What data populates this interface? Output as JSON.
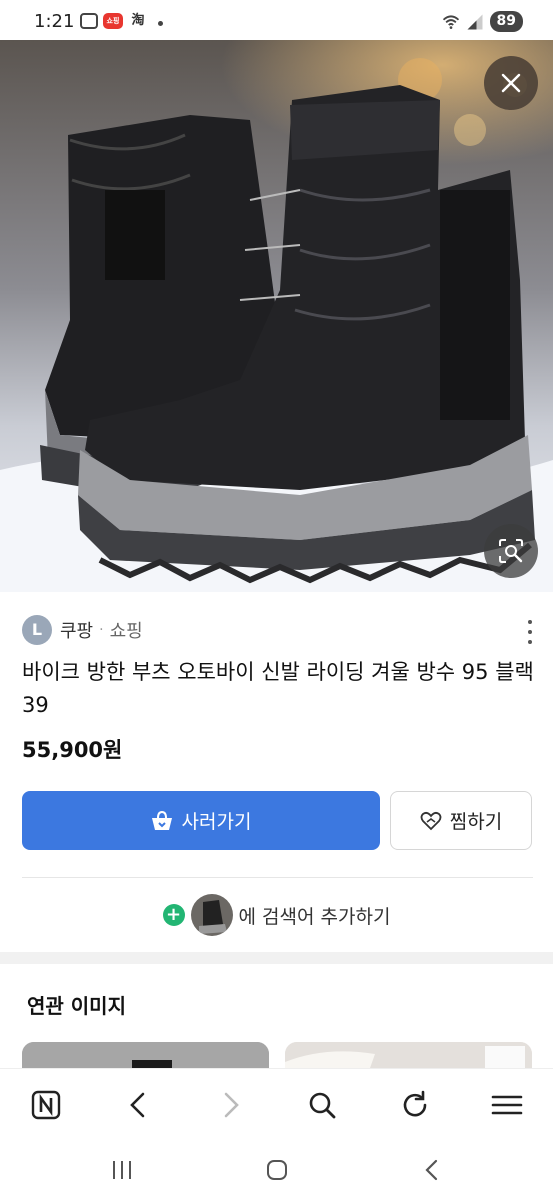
{
  "status_bar": {
    "time": "1:21",
    "app_badge": "쇼핑",
    "taobao_glyph": "淘",
    "battery": "89"
  },
  "hero": {
    "close_icon": "close-icon",
    "lens_icon": "lens-search-icon"
  },
  "product": {
    "source_initial": "L",
    "source_name": "쿠팡",
    "source_separator": "·",
    "source_type": "쇼핑",
    "title": "바이크 방한 부츠 오토바이 신발 라이딩 겨울 방수 95 블랙 39",
    "price": "55,900원"
  },
  "actions": {
    "buy_label": "사러가기",
    "fav_label": "찜하기"
  },
  "add_search": {
    "plus": "+",
    "text": "에 검색어 추가하기"
  },
  "related": {
    "title": "연관 이미지"
  },
  "colors": {
    "primary": "#3c78e0",
    "plus_green": "#22b573"
  }
}
